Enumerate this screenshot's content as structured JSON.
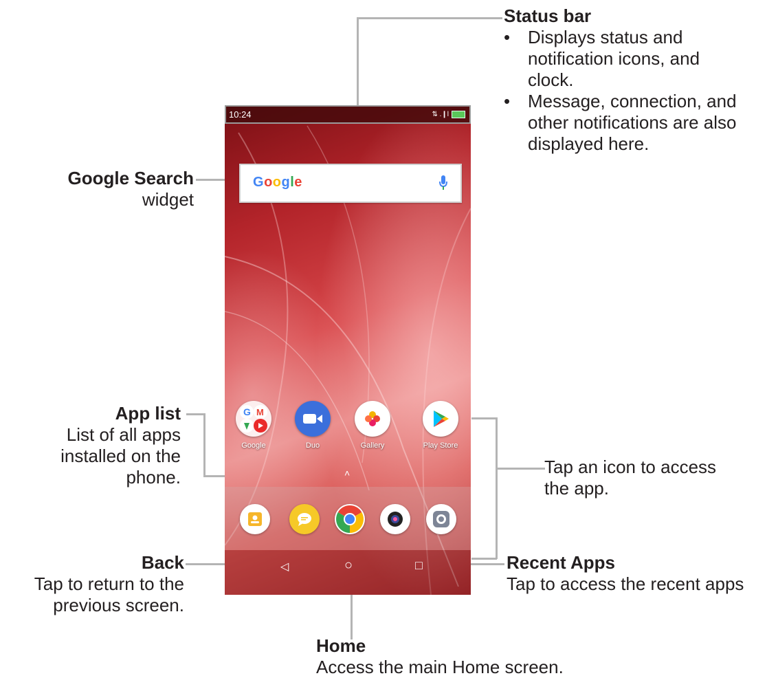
{
  "callouts": {
    "status_bar": {
      "title": "Status bar",
      "bullets": [
        [
          "Displays status and",
          "notification icons, and",
          "clock."
        ],
        [
          "Message, connection, and",
          "other notifications are also",
          "displayed here."
        ]
      ]
    },
    "google_search": {
      "title": "Google Search",
      "subtitle": "widget"
    },
    "app_list": {
      "title": "App list",
      "lines": [
        "List of all apps",
        "installed on the",
        "phone."
      ]
    },
    "tap_icon": {
      "lines": [
        "Tap an icon to access",
        "the app."
      ]
    },
    "back": {
      "title": "Back",
      "lines": [
        "Tap to return to the",
        "previous screen."
      ]
    },
    "recent": {
      "title": "Recent Apps",
      "lines": [
        "Tap to access the recent apps"
      ]
    },
    "home": {
      "title": "Home",
      "lines": [
        "Access the main Home screen."
      ]
    }
  },
  "phone": {
    "clock": "10:24",
    "signal_text": "⇅ .❙l",
    "search": {
      "logo": "Google",
      "mic_icon": "mic-icon"
    },
    "apps": [
      {
        "label": "Google",
        "icon": "google-folder-icon"
      },
      {
        "label": "Duo",
        "icon": "duo-icon",
        "color": "#3b6fdb"
      },
      {
        "label": "Gallery",
        "icon": "gallery-icon",
        "color": "#ffffff"
      },
      {
        "label": "Play Store",
        "icon": "play-store-icon",
        "color": "#ffffff"
      }
    ],
    "caret": "˄",
    "dock": [
      {
        "icon": "contacts-icon",
        "color": "#f6b62a"
      },
      {
        "icon": "messages-icon",
        "color": "#f6c928"
      },
      {
        "icon": "chrome-icon",
        "color": "#ffffff"
      },
      {
        "icon": "camera-icon",
        "color": "#ffffff"
      },
      {
        "icon": "settings-icon",
        "color": "#ffffff"
      }
    ],
    "nav": {
      "back": "◁",
      "home": "○",
      "recent": "□"
    }
  },
  "colors": {
    "line": "#b4b4b4",
    "text": "#231f20",
    "wallpaper": "#c8353a"
  }
}
